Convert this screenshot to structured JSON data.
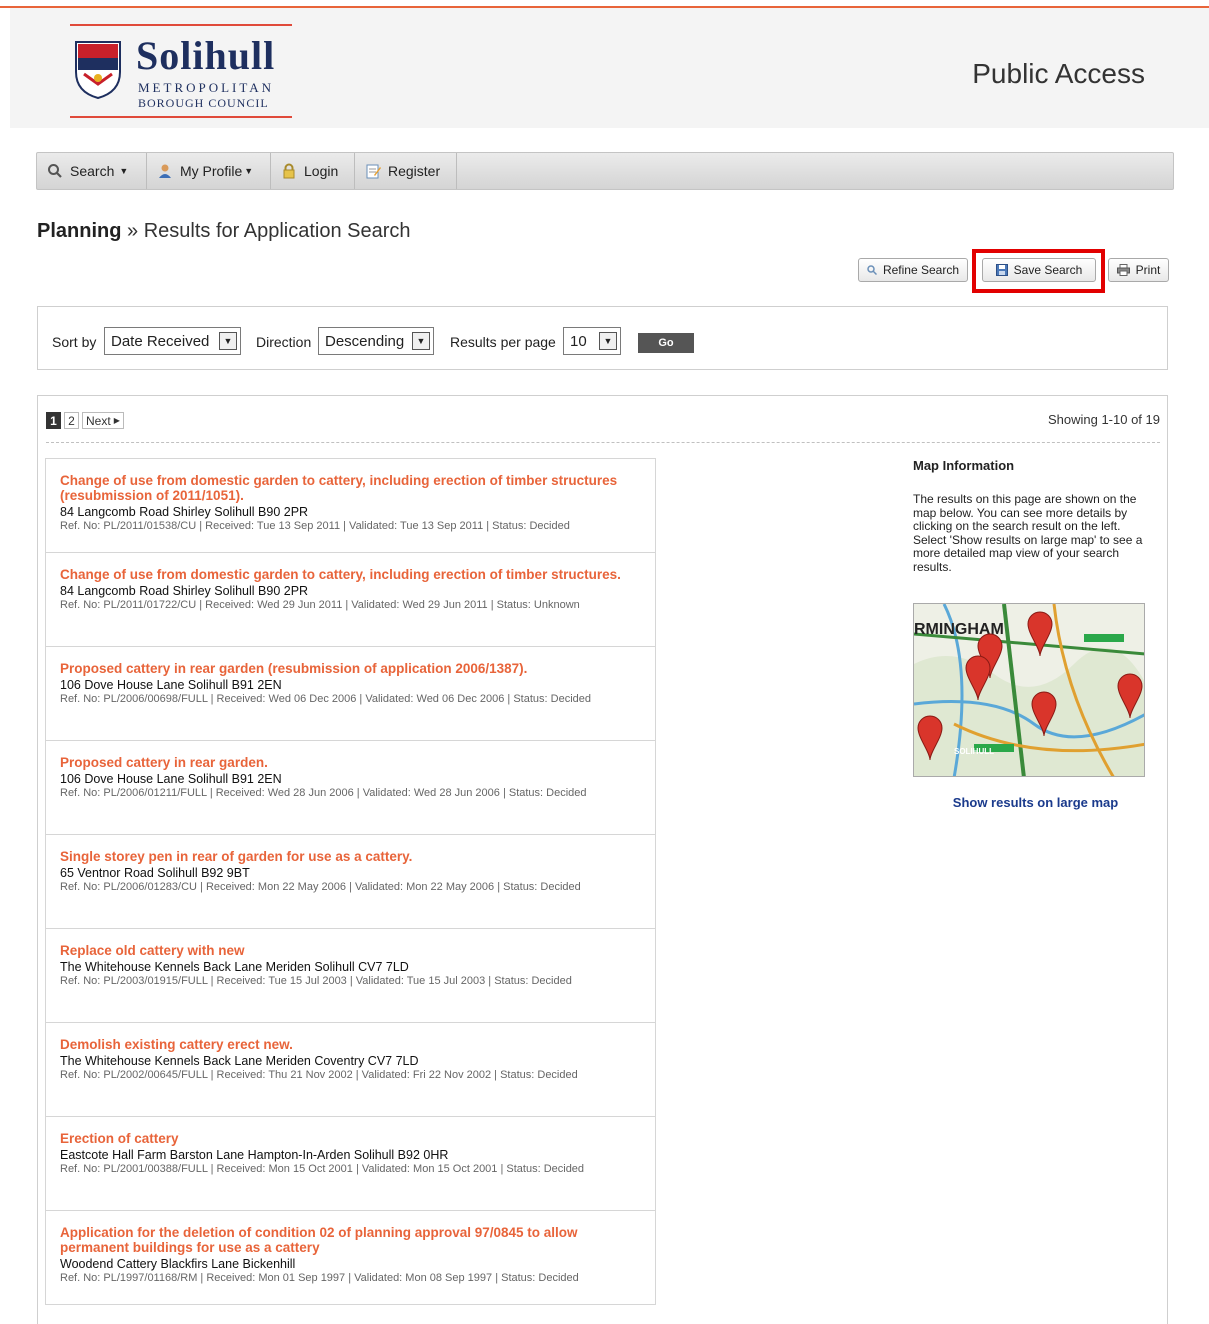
{
  "header": {
    "logo": {
      "name": "Solihull",
      "line1": "METROPOLITAN",
      "line2": "BOROUGH COUNCIL"
    },
    "site_title": "Public Access"
  },
  "nav": {
    "search": "Search",
    "my_profile": "My Profile",
    "login": "Login",
    "register": "Register"
  },
  "breadcrumb": {
    "section": "Planning",
    "separator": " » ",
    "page": "Results for Application Search"
  },
  "actions": {
    "refine": "Refine Search",
    "save": "Save Search",
    "print": "Print"
  },
  "sort": {
    "sort_by_label": "Sort by",
    "sort_by_value": "Date Received",
    "direction_label": "Direction",
    "direction_value": "Descending",
    "per_page_label": "Results per page",
    "per_page_value": "10",
    "go": "Go"
  },
  "pager": {
    "pages": [
      "1",
      "2"
    ],
    "next": "Next",
    "showing": "Showing 1-10 of 19"
  },
  "results": [
    {
      "title": "Change of use from domestic garden to cattery, including erection of timber structures (resubmission of 2011/1051).",
      "address": "84 Langcomb Road Shirley Solihull B90 2PR",
      "meta": "Ref. No: PL/2011/01538/CU | Received: Tue 13 Sep 2011 | Validated: Tue 13 Sep 2011 | Status: Decided"
    },
    {
      "title": "Change of use from domestic garden to cattery, including erection of timber structures.",
      "address": "84 Langcomb Road Shirley Solihull B90 2PR",
      "meta": "Ref. No: PL/2011/01722/CU | Received: Wed 29 Jun 2011 | Validated: Wed 29 Jun 2011 | Status: Unknown"
    },
    {
      "title": "Proposed cattery in rear garden (resubmission of application 2006/1387).",
      "address": "106 Dove House Lane Solihull B91 2EN",
      "meta": "Ref. No: PL/2006/00698/FULL | Received: Wed 06 Dec 2006 | Validated: Wed 06 Dec 2006 | Status: Decided"
    },
    {
      "title": "Proposed cattery in rear garden.",
      "address": "106 Dove House Lane Solihull B91 2EN",
      "meta": "Ref. No: PL/2006/01211/FULL | Received: Wed 28 Jun 2006 | Validated: Wed 28 Jun 2006 | Status: Decided"
    },
    {
      "title": "Single storey pen in rear of garden for use as a cattery.",
      "address": "65 Ventnor Road Solihull B92 9BT",
      "meta": "Ref. No: PL/2006/01283/CU | Received: Mon 22 May 2006 | Validated: Mon 22 May 2006 | Status: Decided"
    },
    {
      "title": "Replace old cattery with new",
      "address": "The Whitehouse Kennels Back Lane Meriden Solihull CV7 7LD",
      "meta": "Ref. No: PL/2003/01915/FULL | Received: Tue 15 Jul 2003 | Validated: Tue 15 Jul 2003 | Status: Decided"
    },
    {
      "title": "Demolish existing cattery erect new.",
      "address": "The Whitehouse Kennels Back Lane Meriden Coventry CV7 7LD",
      "meta": "Ref. No: PL/2002/00645/FULL | Received: Thu 21 Nov 2002 | Validated: Fri 22 Nov 2002 | Status: Decided"
    },
    {
      "title": "Erection of cattery",
      "address": "Eastcote Hall Farm Barston Lane Hampton-In-Arden Solihull B92 0HR",
      "meta": "Ref. No: PL/2001/00388/FULL | Received: Mon 15 Oct 2001 | Validated: Mon 15 Oct 2001 | Status: Decided"
    },
    {
      "title": "Application for the deletion of condition 02 of planning approval 97/0845 to allow permanent buildings for use as a cattery",
      "address": "Woodend Cattery Blackfirs Lane Bickenhill",
      "meta": "Ref. No: PL/1997/01168/RM | Received: Mon 01 Sep 1997 | Validated: Mon 08 Sep 1997 | Status: Decided"
    }
  ],
  "map": {
    "heading": "Map Information",
    "text": "The results on this page are shown on the map below. You can see more details by clicking on the search result on the left. Select 'Show results on large map' to see a more detailed map view of your search results.",
    "map_label": "RMINGHAM",
    "map_place": "SOLIHULL",
    "link": "Show results on large map"
  },
  "colors": {
    "accent": "#e8643a",
    "link": "#1a3a8c",
    "highlight": "#e20000"
  }
}
